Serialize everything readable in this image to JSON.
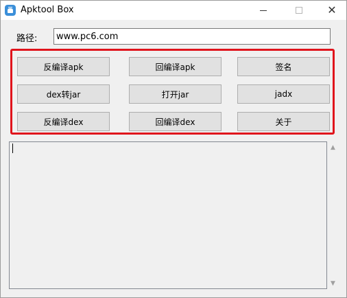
{
  "window": {
    "title": "Apktool Box",
    "close_glyph": "✕"
  },
  "path": {
    "label": "路径:",
    "value": "www.pc6.com"
  },
  "buttons": [
    [
      "反编译apk",
      "回编译apk",
      "签名"
    ],
    [
      "dex转jar",
      "打开jar",
      "jadx"
    ],
    [
      "反编译dex",
      "回编译dex",
      "关于"
    ]
  ],
  "log": {
    "value": ""
  },
  "icons": {
    "app": "android-icon",
    "scroll_up": "▲",
    "scroll_down": "▼"
  },
  "colors": {
    "highlight": "#e0141c",
    "button_bg": "#e1e1e1",
    "window_bg": "#f0f0f0"
  }
}
